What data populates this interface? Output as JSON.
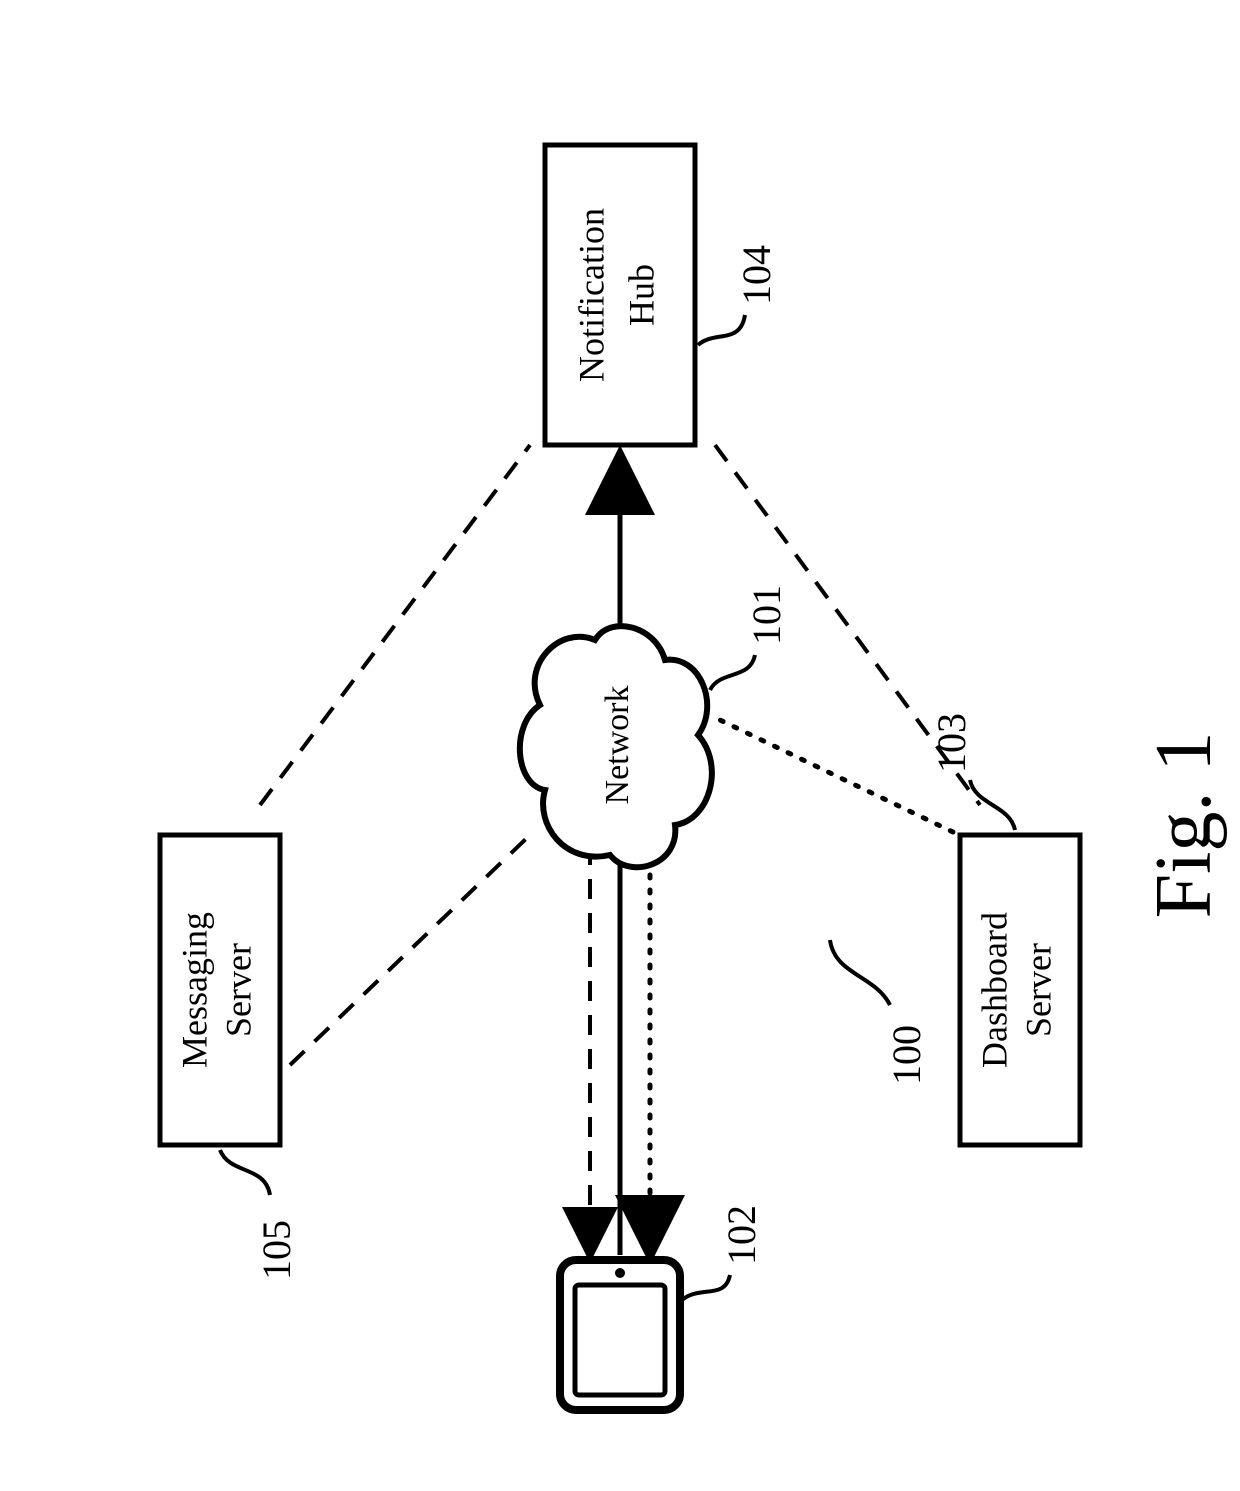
{
  "figure": {
    "caption": "Fig. 1",
    "systemRef": "100"
  },
  "nodes": {
    "network": {
      "label": "Network",
      "ref": "101"
    },
    "device": {
      "label": "",
      "ref": "102"
    },
    "dashboard": {
      "label1": "Dashboard",
      "label2": "Server",
      "ref": "103"
    },
    "notification": {
      "label1": "Notification",
      "label2": "Hub",
      "ref": "104"
    },
    "messaging": {
      "label1": "Messaging",
      "label2": "Server",
      "ref": "105"
    }
  }
}
